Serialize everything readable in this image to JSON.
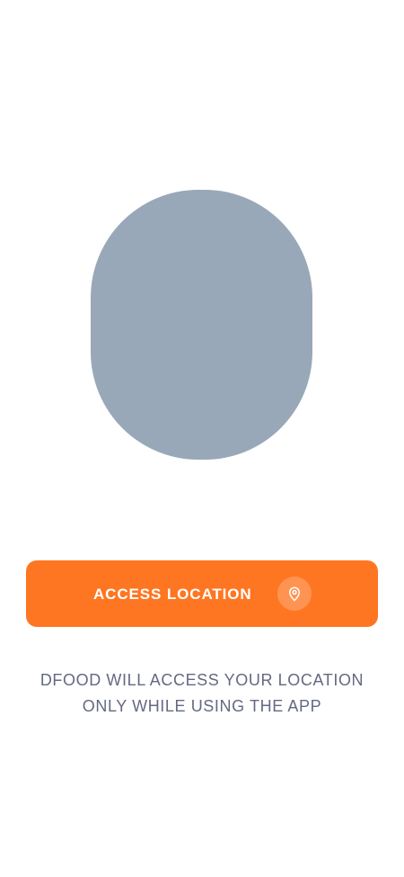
{
  "colors": {
    "background": "#FFFFFF",
    "placeholder": "#98A8B8",
    "accent": "#FF7622",
    "note_text": "#646982"
  },
  "illustration": {
    "icon": "image-placeholder"
  },
  "access_button": {
    "label": "ACCESS LOCATION",
    "icon": "map-pin-icon"
  },
  "note": {
    "line1": "DFOOD WILL ACCESS YOUR LOCATION",
    "line2": "ONLY WHILE USING THE APP"
  }
}
